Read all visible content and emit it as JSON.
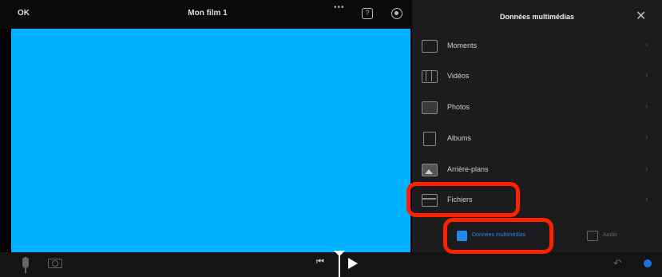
{
  "topbar": {
    "done_label": "OK",
    "project_title": "Mon film 1",
    "more_glyph": "•••",
    "help_glyph": "?"
  },
  "panel": {
    "title": "Données multimédias",
    "close_glyph": "✕",
    "items": [
      {
        "label": "Moments",
        "icon": "moments-icon"
      },
      {
        "label": "Vidéos",
        "icon": "film-icon"
      },
      {
        "label": "Photos",
        "icon": "photo-icon"
      },
      {
        "label": "Albums",
        "icon": "album-icon"
      },
      {
        "label": "Arrière-plans",
        "icon": "background-icon"
      },
      {
        "label": "Fichiers",
        "icon": "files-icon"
      }
    ],
    "chevron": "›",
    "tabs": {
      "media_label": "Données multimédias",
      "audio_label": "Audio"
    }
  },
  "bottombar": {
    "skip_back_glyph": "⏮",
    "undo_glyph": "↶"
  },
  "colors": {
    "preview": "#00b2ff",
    "accent": "#1e8ce8",
    "highlight": "#ff2000"
  }
}
